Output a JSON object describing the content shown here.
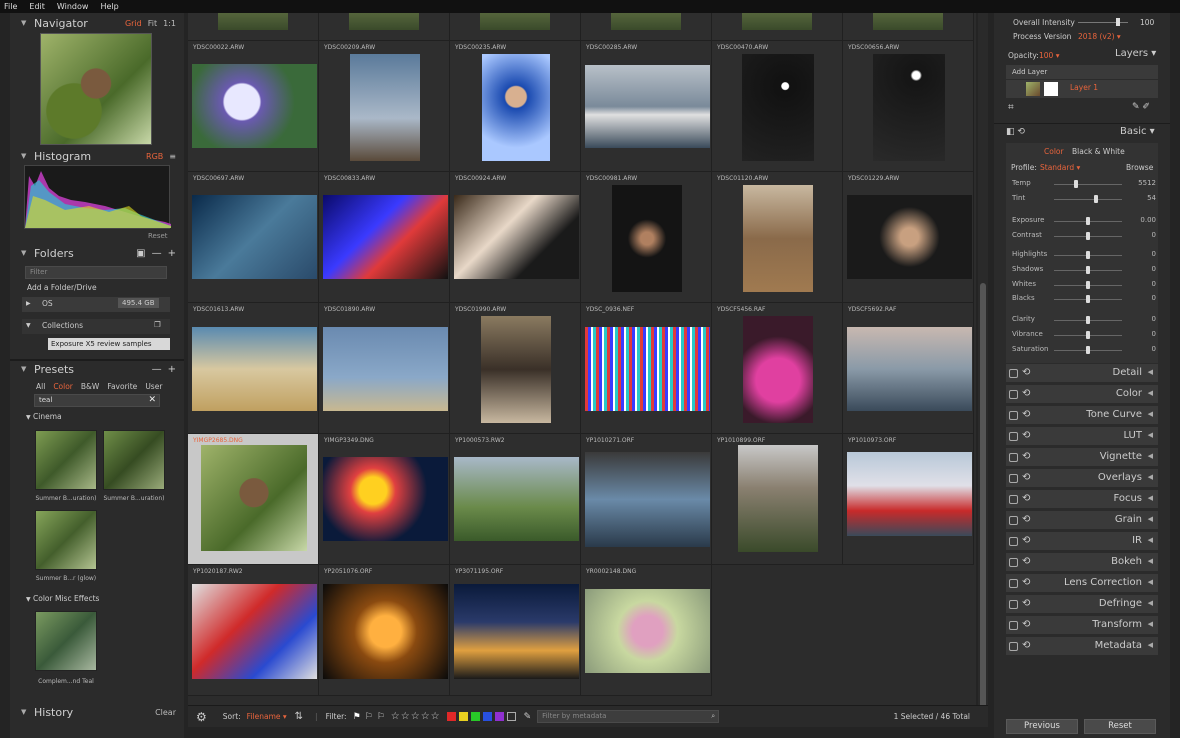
{
  "menu": [
    "File",
    "Edit",
    "Window",
    "Help"
  ],
  "navigator": {
    "title": "Navigator",
    "opts": [
      "Grid",
      "Fit",
      "1:1"
    ]
  },
  "histogram": {
    "title": "Histogram",
    "mode": "RGB",
    "reset": "Reset"
  },
  "folders": {
    "title": "Folders",
    "filter_placeholder": "Filter",
    "add": "Add a Folder/Drive",
    "os": "OS",
    "os_size": "495.4 GB",
    "collections": "Collections",
    "tooltip": "Exposure X5 review samples"
  },
  "presets": {
    "title": "Presets",
    "tabs": [
      "All",
      "Color",
      "B&W",
      "Favorite",
      "User"
    ],
    "search": "teal",
    "cinema": "Cinema",
    "items": [
      "Summer B...uration)",
      "Summer B...uration)",
      "Summer B...r (glow)"
    ],
    "misc": "Color Misc Effects",
    "misc_item": "Complem...nd Teal"
  },
  "history": {
    "title": "History",
    "clear": "Clear"
  },
  "grid": {
    "cells": [
      {
        "fn": "YDSC00022.ARW"
      },
      {
        "fn": "YDSC00209.ARW"
      },
      {
        "fn": "YDSC00235.ARW"
      },
      {
        "fn": "YDSC00285.ARW"
      },
      {
        "fn": "YDSC00470.ARW"
      },
      {
        "fn": "YDSC00656.ARW"
      },
      {
        "fn": "YDSC00697.ARW"
      },
      {
        "fn": "YDSC00833.ARW"
      },
      {
        "fn": "YDSC00924.ARW"
      },
      {
        "fn": "YDSC00981.ARW"
      },
      {
        "fn": "YDSC01120.ARW"
      },
      {
        "fn": "YDSC01229.ARW"
      },
      {
        "fn": "YDSC01613.ARW"
      },
      {
        "fn": "YDSC01890.ARW"
      },
      {
        "fn": "YDSC01990.ARW"
      },
      {
        "fn": "YDSC_0936.NEF"
      },
      {
        "fn": "YDSCF5456.RAF"
      },
      {
        "fn": "YDSCF5692.RAF"
      },
      {
        "fn": "YIMGP2685.DNG"
      },
      {
        "fn": "YIMGP3349.DNG"
      },
      {
        "fn": "YP1000573.RW2"
      },
      {
        "fn": "YP1010271.ORF"
      },
      {
        "fn": "YP1010899.ORF"
      },
      {
        "fn": "YP1010973.ORF"
      },
      {
        "fn": "YP1020187.RW2"
      },
      {
        "fn": "YP2051076.ORF"
      },
      {
        "fn": "YP3071195.ORF"
      },
      {
        "fn": "YR0002148.DNG"
      }
    ]
  },
  "toolbar": {
    "sort": "Sort:",
    "sort_val": "Filename",
    "filter": "Filter:",
    "meta_placeholder": "Filter by metadata",
    "status": "1 Selected / 46 Total"
  },
  "right": {
    "overall": "Overall Intensity",
    "overall_val": "100",
    "process": "Process Version",
    "process_val": "2018 (v2)",
    "opacity": "Opacity:",
    "opacity_val": "100",
    "layers": "Layers",
    "add_layer": "Add Layer",
    "layer1": "Layer 1",
    "basic": "Basic",
    "color": "Color",
    "bw": "Black & White",
    "profile": "Profile:",
    "profile_val": "Standard",
    "browse": "Browse",
    "adjust": [
      {
        "n": "Temp",
        "v": "5512",
        "k": 0.32
      },
      {
        "n": "Tint",
        "v": "54",
        "k": 0.62
      },
      {
        "n": "Exposure",
        "v": "0.00",
        "k": 0.5
      },
      {
        "n": "Contrast",
        "v": "0",
        "k": 0.5
      },
      {
        "n": "Highlights",
        "v": "0",
        "k": 0.5
      },
      {
        "n": "Shadows",
        "v": "0",
        "k": 0.5
      },
      {
        "n": "Whites",
        "v": "0",
        "k": 0.5
      },
      {
        "n": "Blacks",
        "v": "0",
        "k": 0.5
      },
      {
        "n": "Clarity",
        "v": "0",
        "k": 0.5
      },
      {
        "n": "Vibrance",
        "v": "0",
        "k": 0.5
      },
      {
        "n": "Saturation",
        "v": "0",
        "k": 0.5
      }
    ],
    "panels": [
      "Detail",
      "Color",
      "Tone Curve",
      "LUT",
      "Vignette",
      "Overlays",
      "Focus",
      "Grain",
      "IR",
      "Bokeh",
      "Lens Correction",
      "Defringe",
      "Transform",
      "Metadata"
    ],
    "prev": "Previous",
    "reset": "Reset"
  }
}
